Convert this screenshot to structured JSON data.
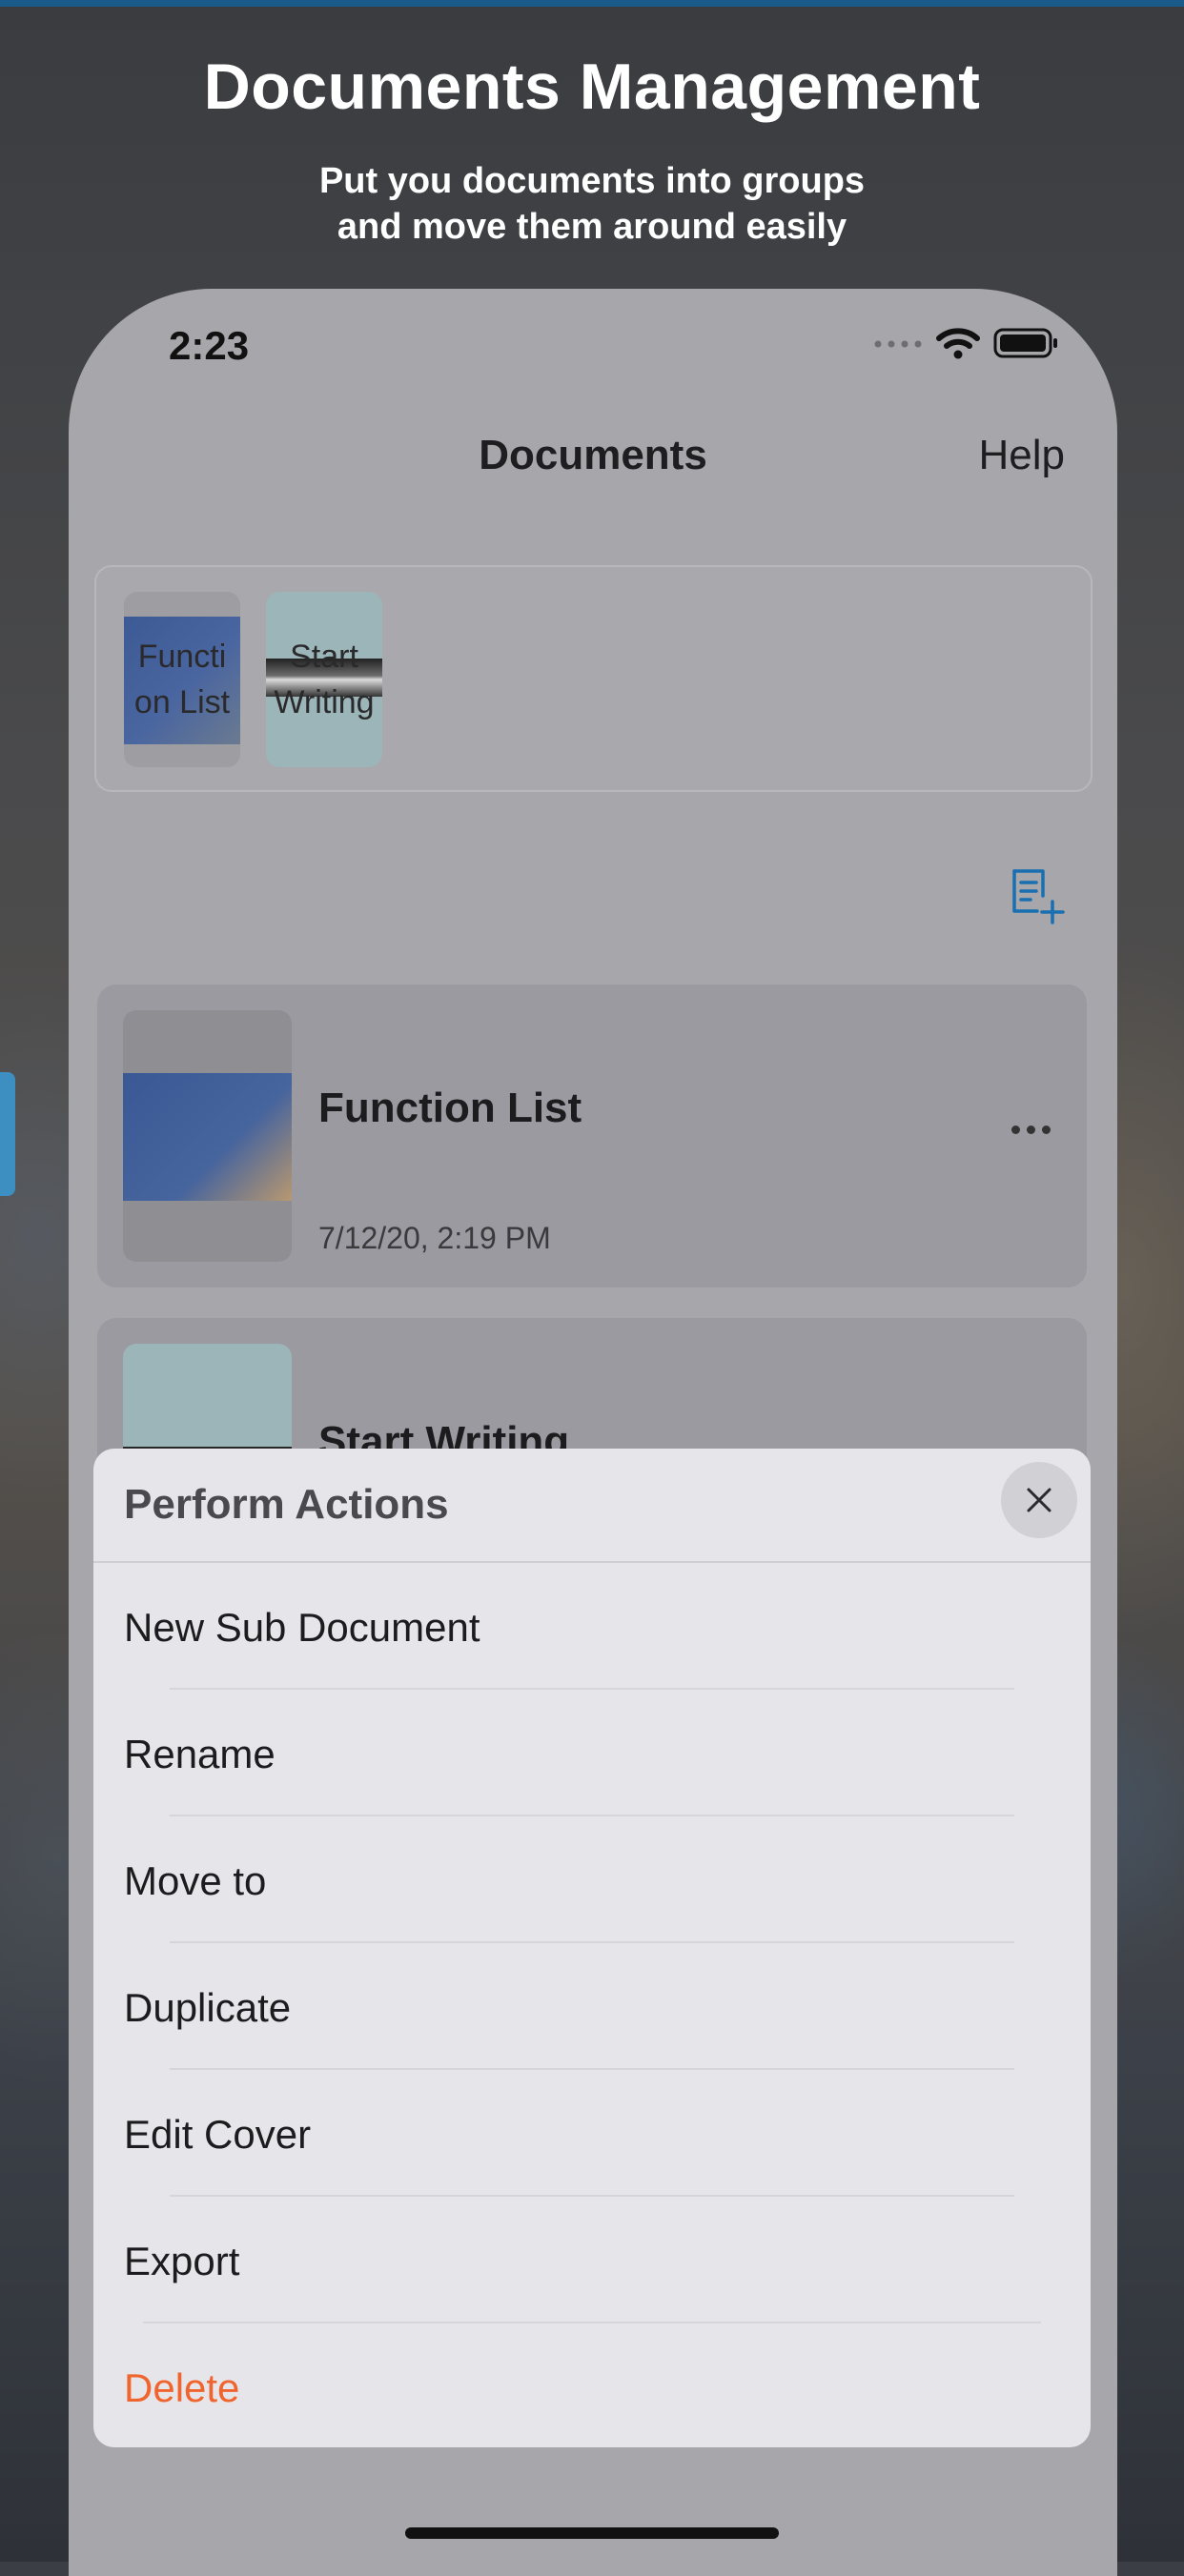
{
  "promo": {
    "headline": "Documents Management",
    "subline_1": "Put you documents into groups",
    "subline_2": "and move them around easily"
  },
  "status_bar": {
    "time": "2:23"
  },
  "nav": {
    "title": "Documents",
    "help": "Help"
  },
  "groups": [
    {
      "label": "Function List"
    },
    {
      "label": "Start Writing"
    }
  ],
  "documents": [
    {
      "title": "Function List",
      "date": "7/12/20, 2:19 PM"
    },
    {
      "title": "Start Writing"
    }
  ],
  "action_sheet": {
    "title": "Perform Actions",
    "actions": [
      {
        "label": "New Sub Document"
      },
      {
        "label": "Rename"
      },
      {
        "label": "Move to"
      },
      {
        "label": "Duplicate"
      },
      {
        "label": "Edit Cover"
      },
      {
        "label": "Export"
      },
      {
        "label": "Delete"
      }
    ]
  },
  "colors": {
    "accent": "#1a6fb0",
    "danger": "#f0652d"
  },
  "icons": [
    "wifi-icon",
    "battery-icon",
    "signal-icon",
    "new-document-icon",
    "more-icon",
    "close-icon"
  ]
}
